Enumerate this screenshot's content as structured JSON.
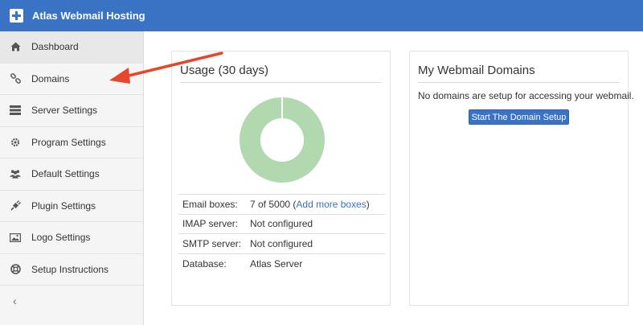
{
  "app": {
    "title": "Atlas Webmail Hosting"
  },
  "sidebar": {
    "items": [
      {
        "label": "Dashboard",
        "icon": "home-icon"
      },
      {
        "label": "Domains",
        "icon": "link-icon"
      },
      {
        "label": "Server Settings",
        "icon": "server-icon"
      },
      {
        "label": "Program Settings",
        "icon": "gear-icon"
      },
      {
        "label": "Default Settings",
        "icon": "users-icon"
      },
      {
        "label": "Plugin Settings",
        "icon": "plug-icon"
      },
      {
        "label": "Logo Settings",
        "icon": "image-icon"
      },
      {
        "label": "Setup Instructions",
        "icon": "lifebuoy-icon"
      }
    ],
    "collapse_label": "‹"
  },
  "usage": {
    "title": "Usage (30 days)",
    "donut_color": "#b2d8b0",
    "used_fraction": 0.0014,
    "rows": {
      "email_label": "Email boxes:",
      "email_count": "7 of 5000",
      "email_open": "(",
      "email_link": "Add more boxes",
      "email_close": ")",
      "imap_label": "IMAP server:",
      "imap_value": "Not configured",
      "smtp_label": "SMTP server:",
      "smtp_value": "Not configured",
      "db_label": "Database:",
      "db_value": "Atlas Server"
    }
  },
  "domains": {
    "title": "My Webmail Domains",
    "empty_message": "No domains are setup for accessing your webmail.",
    "setup_button": "Start The Domain Setup"
  },
  "colors": {
    "accent": "#3a72c4",
    "annotation_arrow": "#e8462b"
  }
}
